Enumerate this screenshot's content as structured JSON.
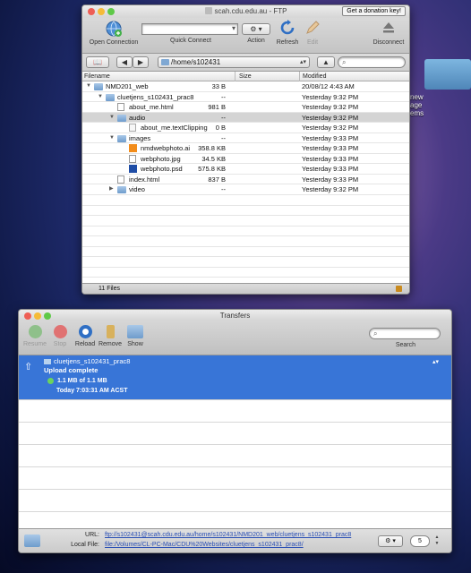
{
  "desktop": {
    "label_lines": [
      "new",
      "age",
      "ems"
    ]
  },
  "ftp": {
    "title": "scah.cdu.edu.au - FTP",
    "donation_button": "Get a donation key!",
    "toolbar": {
      "open_connection": "Open Connection",
      "quick_connect": "Quick Connect",
      "action": "Action",
      "refresh": "Refresh",
      "edit": "Edit",
      "disconnect": "Disconnect"
    },
    "path": "/home/s102431",
    "columns": {
      "filename": "Filename",
      "size": "Size",
      "modified": "Modified"
    },
    "files": [
      {
        "name": "NMD201_web",
        "size": "33 B",
        "modified": "20/08/12 4:43 AM",
        "type": "folder",
        "depth": 0,
        "expanded": true,
        "selected": false
      },
      {
        "name": "cluetjens_s102431_prac8",
        "size": "--",
        "modified": "Yesterday 9:32 PM",
        "type": "folder",
        "depth": 1,
        "expanded": true,
        "selected": false
      },
      {
        "name": "about_me.html",
        "size": "981 B",
        "modified": "Yesterday 9:32 PM",
        "type": "html",
        "depth": 2,
        "expanded": false,
        "selected": false
      },
      {
        "name": "audio",
        "size": "--",
        "modified": "Yesterday 9:32 PM",
        "type": "folder",
        "depth": 2,
        "expanded": true,
        "selected": true
      },
      {
        "name": "about_me.textClipping",
        "size": "0 B",
        "modified": "Yesterday 9:32 PM",
        "type": "clip",
        "depth": 3,
        "expanded": false,
        "selected": false
      },
      {
        "name": "images",
        "size": "--",
        "modified": "Yesterday 9:33 PM",
        "type": "folder",
        "depth": 2,
        "expanded": true,
        "selected": false
      },
      {
        "name": "nmdwebphoto.ai",
        "size": "358.8 KB",
        "modified": "Yesterday 9:33 PM",
        "type": "ai",
        "depth": 3,
        "expanded": false,
        "selected": false
      },
      {
        "name": "webphoto.jpg",
        "size": "34.5 KB",
        "modified": "Yesterday 9:33 PM",
        "type": "jpg",
        "depth": 3,
        "expanded": false,
        "selected": false
      },
      {
        "name": "webphoto.psd",
        "size": "575.8 KB",
        "modified": "Yesterday 9:33 PM",
        "type": "psd",
        "depth": 3,
        "expanded": false,
        "selected": false
      },
      {
        "name": "index.html",
        "size": "837 B",
        "modified": "Yesterday 9:33 PM",
        "type": "html",
        "depth": 2,
        "expanded": false,
        "selected": false
      },
      {
        "name": "video",
        "size": "--",
        "modified": "Yesterday 9:32 PM",
        "type": "folder",
        "depth": 2,
        "expanded": false,
        "selected": false
      }
    ],
    "status": "11 Files"
  },
  "transfers": {
    "title": "Transfers",
    "toolbar": {
      "resume": "Resume",
      "stop": "Stop",
      "reload": "Reload",
      "remove": "Remove",
      "show": "Show",
      "search": "Search"
    },
    "item": {
      "name": "cluetjens_s102431_prac8",
      "status": "Upload complete",
      "progress": "1.1 MB of 1.1 MB",
      "time": "Today 7:03:31 AM ACST"
    },
    "footer": {
      "url_label": "URL:",
      "url_value": "ftp://s102431@scah.cdu.edu.au/home/s102431/NMD201_web/cluetjens_s102431_prac8",
      "local_label": "Local File:",
      "local_value": "file:/Volumes/CL-PC-Mac/CDU%20Websites/cluetjens_s102431_prac8/",
      "connections": "5"
    }
  },
  "colors": {
    "selection_blue": "#3875d7",
    "selected_gray": "#d4d4d4",
    "close_red": "#ee5e55",
    "minimize_yellow": "#f5bb38",
    "zoom_green": "#5fc948"
  }
}
